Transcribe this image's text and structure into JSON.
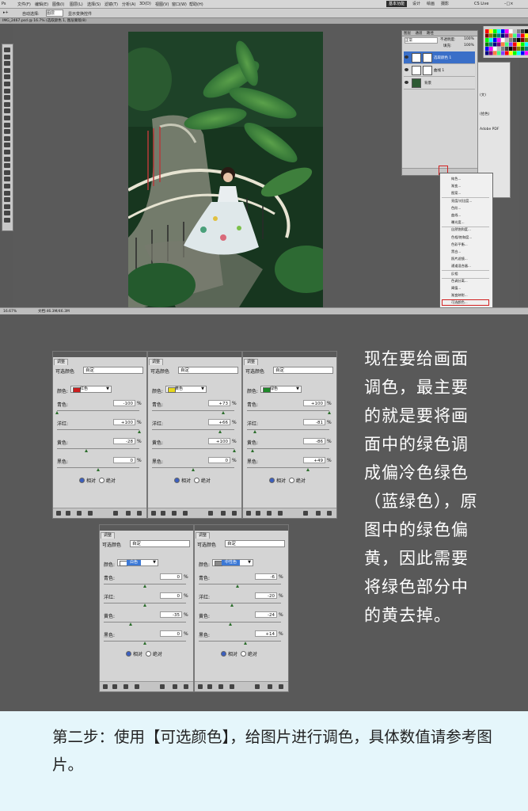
{
  "menubar": {
    "items": [
      "文件(F)",
      "编辑(E)",
      "图像(I)",
      "图层(L)",
      "选择(S)",
      "滤镜(T)",
      "分析(A)",
      "3D(D)",
      "视图(V)",
      "窗口(W)",
      "帮助(H)"
    ],
    "workspace": [
      "基本功能",
      "设计",
      "绘画",
      "摄影"
    ],
    "cslive": "CS Live"
  },
  "optbar": {
    "auto_select": "自动选择:",
    "auto_select_value": "图层",
    "show_transform": "显示变换控件"
  },
  "doc_tab": "IMG_2467.psd @ 16.7% (选取颜色 1, 图层蒙版/8)",
  "statusbar": {
    "zoom": "16.67%",
    "doc": "文档:46.3M/46.3M"
  },
  "layers_panel": {
    "tabs": [
      "图层",
      "通道",
      "路径"
    ],
    "blend_mode": "正常",
    "opacity_label": "不透明度:",
    "opacity": "100%",
    "fill_label": "填充:",
    "fill": "100%",
    "layers": [
      "选取颜色 1",
      "曲线 1",
      "背景"
    ]
  },
  "side_panel": [
    "(文)",
    "(拾色)",
    "Adobe PDF"
  ],
  "adjust_menu": {
    "items": [
      "纯色...",
      "渐变...",
      "图案...",
      "亮度/对比度...",
      "色阶...",
      "曲线...",
      "曝光度...",
      "自然饱和度...",
      "色相/饱和度...",
      "色彩平衡...",
      "黑白...",
      "照片滤镜...",
      "通道混合器...",
      "反相",
      "色调分离...",
      "阈值...",
      "渐变映射...",
      "可选颜色..."
    ]
  },
  "adjustments": [
    {
      "tab": "调整",
      "preset_label": "可选颜色",
      "preset": "自定",
      "color_label": "颜色:",
      "color": "红色",
      "swatch": "#cc1f1f",
      "sliders": [
        {
          "label": "青色:",
          "value": "-100"
        },
        {
          "label": "洋红:",
          "value": "+100"
        },
        {
          "label": "黄色:",
          "value": "-28"
        },
        {
          "label": "黑色:",
          "value": "0"
        }
      ],
      "pct": "%",
      "relative": "相对",
      "absolute": "绝对"
    },
    {
      "tab": "调整",
      "preset_label": "可选颜色",
      "preset": "自定",
      "color_label": "颜色:",
      "color": "黄色",
      "swatch": "#e7d81d",
      "sliders": [
        {
          "label": "青色:",
          "value": "+73"
        },
        {
          "label": "洋红:",
          "value": "+66"
        },
        {
          "label": "黄色:",
          "value": "+100"
        },
        {
          "label": "黑色:",
          "value": "0"
        }
      ],
      "pct": "%",
      "relative": "相对",
      "absolute": "绝对"
    },
    {
      "tab": "调整",
      "preset_label": "可选颜色",
      "preset": "自定",
      "color_label": "颜色:",
      "color": "绿色",
      "swatch": "#1f8a2a",
      "sliders": [
        {
          "label": "青色:",
          "value": "+100"
        },
        {
          "label": "洋红:",
          "value": "-81"
        },
        {
          "label": "黄色:",
          "value": "-86"
        },
        {
          "label": "黑色:",
          "value": "+49"
        }
      ],
      "pct": "%",
      "relative": "相对",
      "absolute": "绝对"
    },
    {
      "tab": "调整",
      "preset_label": "可选颜色",
      "preset": "自定",
      "color_label": "颜色:",
      "color": "白色",
      "swatch": "#ffffff",
      "sliders": [
        {
          "label": "青色:",
          "value": "0"
        },
        {
          "label": "洋红:",
          "value": "0"
        },
        {
          "label": "黄色:",
          "value": "-35"
        },
        {
          "label": "黑色:",
          "value": "0"
        }
      ],
      "pct": "%",
      "relative": "相对",
      "absolute": "绝对"
    },
    {
      "tab": "调整",
      "preset_label": "可选颜色",
      "preset": "自定",
      "color_label": "颜色:",
      "color": "中性色",
      "swatch": "#8a8a8a",
      "sliders": [
        {
          "label": "青色:",
          "value": "-6"
        },
        {
          "label": "洋红:",
          "value": "-20"
        },
        {
          "label": "黄色:",
          "value": "-24"
        },
        {
          "label": "黑色:",
          "value": "+14"
        }
      ],
      "pct": "%",
      "relative": "相对",
      "absolute": "绝对"
    }
  ],
  "instruction": "现在要给画面调色，最主要的就是要将画面中的绿色调成偏冷色绿色（蓝绿色），原图中的绿色偏黄，因此需要将绿色部分中的黄去掉。",
  "step_text": "第二步：使用【可选颜色】，给图片进行调色，具体数值请参考图片。"
}
